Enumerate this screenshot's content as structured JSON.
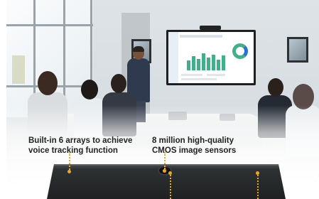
{
  "features": {
    "voice_tracking": {
      "line1": "Built-in 6 arrays to achieve",
      "line2": "voice tracking function"
    },
    "image_sensors": {
      "line1": "8 million high-quality",
      "line2": "CMOS image sensors"
    }
  },
  "colors": {
    "accent_marker": "#f2a51b",
    "device_body": "#2b2d2f",
    "text": "#222222",
    "screen_chart": "#3fb08a"
  },
  "icons": {
    "camera_lens": "camera-lens-icon",
    "hotspot": "hotspot-marker-icon"
  }
}
